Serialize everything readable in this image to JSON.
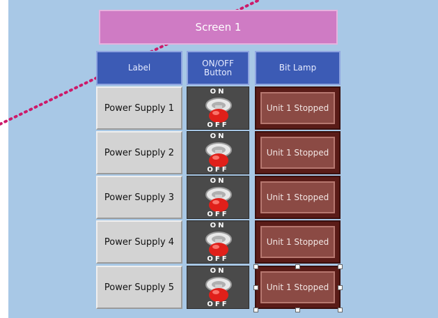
{
  "screen": {
    "title": "Screen 1"
  },
  "table": {
    "headers": [
      "Label",
      "ON/OFF Button",
      "Bit Lamp"
    ],
    "rows": [
      {
        "label": "Power Supply 1",
        "on": "ON",
        "off": "OFF",
        "lamp": "Unit 1 Stopped"
      },
      {
        "label": "Power Supply 2",
        "on": "ON",
        "off": "OFF",
        "lamp": "Unit 1 Stopped"
      },
      {
        "label": "Power Supply 3",
        "on": "ON",
        "off": "OFF",
        "lamp": "Unit 1 Stopped"
      },
      {
        "label": "Power Supply 4",
        "on": "ON",
        "off": "OFF",
        "lamp": "Unit 1 Stopped"
      },
      {
        "label": "Power Supply 5",
        "on": "ON",
        "off": "OFF",
        "lamp": "Unit 1 Stopped"
      }
    ]
  },
  "colors": {
    "background": "#a8c8e6",
    "title_bar": "#cf7bc4",
    "header": "#3c5bb5",
    "lamp": "#8b4a44",
    "button_red": "#e0201a",
    "dotted_line": "#cc1a6a"
  },
  "icons": {
    "switch": "toggle-switch-icon"
  }
}
